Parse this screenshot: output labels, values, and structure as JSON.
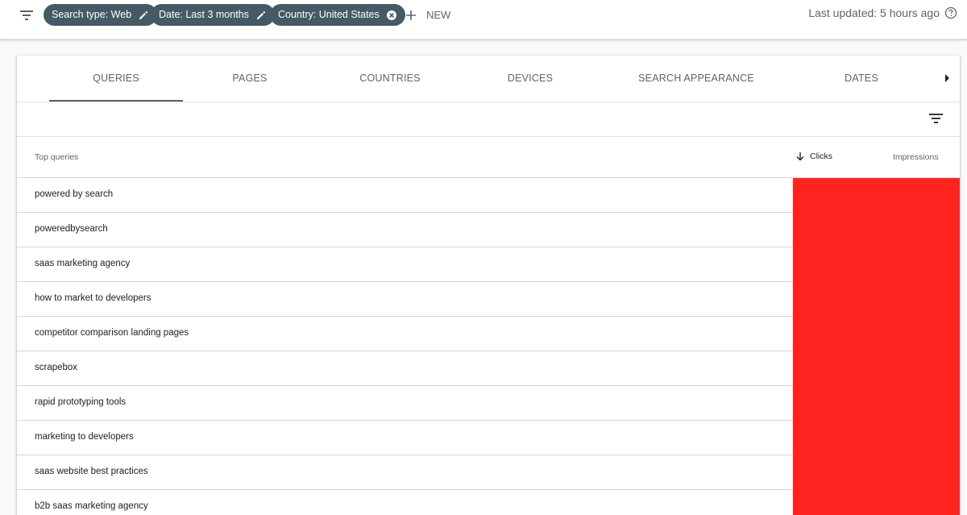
{
  "filter_bar": {
    "chips": [
      {
        "label": "Search type: Web",
        "icon": "pencil-icon"
      },
      {
        "label": "Date: Last 3 months",
        "icon": "pencil-icon"
      },
      {
        "label": "Country: United States",
        "icon": "close-circle-icon"
      }
    ],
    "new_label": "NEW",
    "last_updated": "Last updated: 5 hours ago"
  },
  "tabs": [
    {
      "label": "QUERIES",
      "active": true
    },
    {
      "label": "PAGES"
    },
    {
      "label": "COUNTRIES"
    },
    {
      "label": "DEVICES"
    },
    {
      "label": "SEARCH APPEARANCE"
    },
    {
      "label": "DATES"
    }
  ],
  "table": {
    "headers": {
      "query": "Top queries",
      "clicks": "Clicks",
      "impressions": "Impressions"
    },
    "rows": [
      "powered by search",
      "poweredbysearch",
      "saas marketing agency",
      "how to market to developers",
      "competitor comparison landing pages",
      "scrapebox",
      "rapid prototyping tools",
      "marketing to developers",
      "saas website best practices",
      "b2b saas marketing agency"
    ],
    "redaction_color": "#ff231f"
  },
  "colors": {
    "chip_bg": "#455a64",
    "accent_text": "#5f6368"
  }
}
